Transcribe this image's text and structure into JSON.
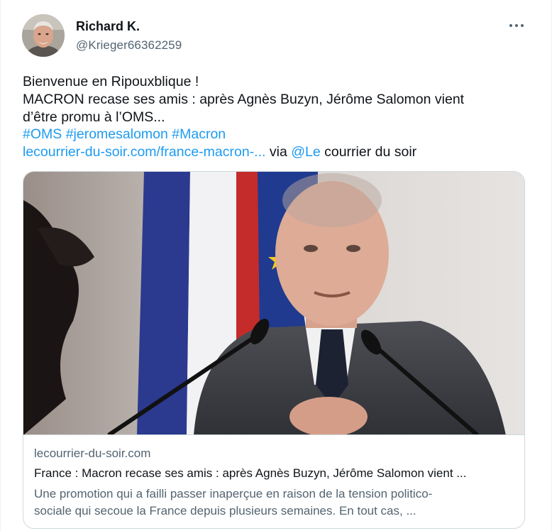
{
  "author": {
    "display_name": "Richard K.",
    "handle": "@Krieger66362259",
    "avatar_icon": "user-avatar-photo"
  },
  "more_icon": "more-dots-icon",
  "tweet": {
    "line1": "Bienvenue en Ripouxblique !",
    "line2": "MACRON recase ses amis : après Agnès Buzyn, Jérôme Salomon vient",
    "line3": "d’être promu à l’OMS...",
    "hashtags": [
      "#OMS",
      "#jeromesalomon",
      "#Macron"
    ],
    "url_text": "lecourrier-du-soir.com/france-macron-...",
    "via_text": " via ",
    "mention": "@Le",
    "after_mention": " courrier du soir"
  },
  "card": {
    "image_alt": "article-photo",
    "domain": "lecourrier-du-soir.com",
    "title": "France : Macron recase ses amis : après Agnès Buzyn, Jérôme Salomon vient ...",
    "description_line1": "Une promotion qui a failli passer inaperçue en raison de la tension politico-",
    "description_line2": "sociale qui secoue la France depuis plusieurs semaines. En tout cas, ..."
  },
  "colors": {
    "link": "#1d9bf0",
    "text": "#0f1419",
    "secondary": "#536471",
    "border": "#cfd9de"
  }
}
